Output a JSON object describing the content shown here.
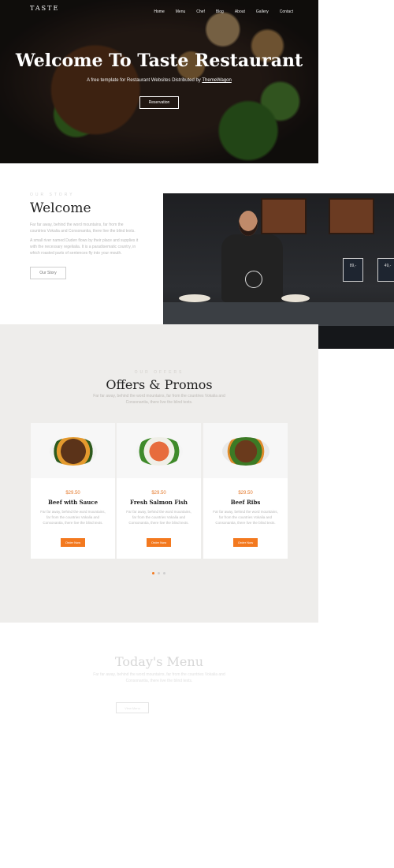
{
  "header": {
    "brand": "TASTE",
    "nav": [
      "Home",
      "Menu",
      "Chef",
      "Blog",
      "About",
      "Gallery",
      "Contact"
    ]
  },
  "hero": {
    "title": "Welcome To Taste Restaurant",
    "subtitle_text": "A free template for Restaurant Websites Distributed by ",
    "subtitle_link": "ThemeWagon",
    "button": "Reservation"
  },
  "welcome": {
    "kicker": "OUR STORY",
    "title": "Welcome",
    "para1": "Far far away, behind the word mountains, far from the countries Vokalia and Consonantia, there live the blind texts.",
    "para2": "A small river named Duden flows by their place and supplies it with the necessary regelialia. It is a paradisematic country, in which roasted parts of sentences fly into your mouth.",
    "button": "Our Story",
    "photo_signs": [
      "89,-",
      "49,-"
    ]
  },
  "offers": {
    "kicker": "OUR OFFERS",
    "title": "Offers & Promos",
    "description": "Far far away, behind the word mountains, far from the countries Vokalia and Consonantia, there live the blind texts.",
    "cards": [
      {
        "price": "$29.50",
        "name": "Beef with Sauce",
        "desc": "Far far away, behind the word mountains, far from the countries Vokalia and Consonantia, there live the blind texts.",
        "button": "Order Now"
      },
      {
        "price": "$29.50",
        "name": "Fresh Salmon Fish",
        "desc": "Far far away, behind the word mountains, far from the countries Vokalia and Consonantia, there live the blind texts.",
        "button": "Order Now"
      },
      {
        "price": "$29.50",
        "name": "Beef Ribs",
        "desc": "Far far away, behind the word mountains, far from the countries Vokalia and Consonantia, there live the blind texts.",
        "button": "Order Now"
      }
    ],
    "carousel_active": 1
  },
  "menu": {
    "title": "Today's Menu",
    "description": "Far far away, behind the word mountains, far from the countries Vokalia and Consonantia, there live the blind texts.",
    "button": "View Menu"
  },
  "colors": {
    "accent": "#f3791f",
    "offers_bg": "#eeedeb"
  }
}
